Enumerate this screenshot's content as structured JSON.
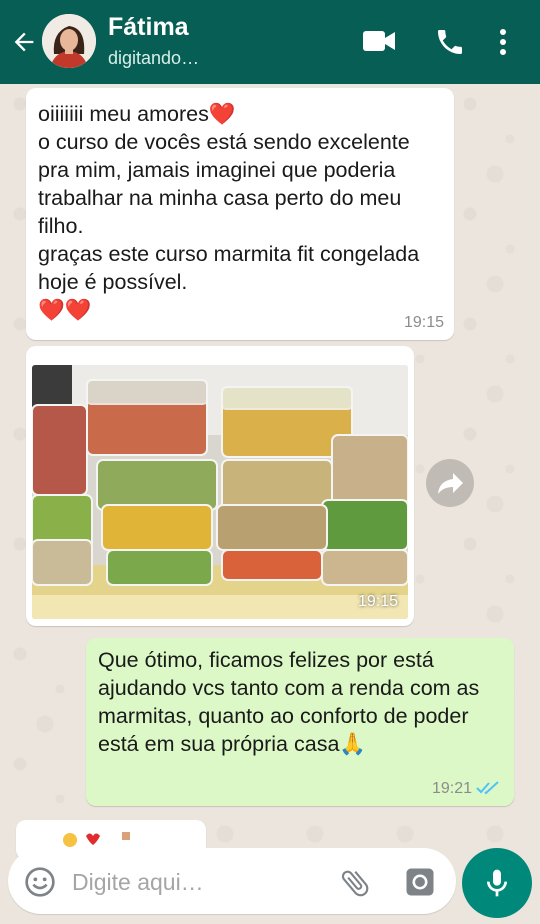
{
  "header": {
    "contact_name": "Fátima",
    "status": "digitando…"
  },
  "messages": [
    {
      "direction": "incoming",
      "text": "oiiiiiii meu amores❤️\no curso de vocês está sendo excelente pra mim, jamais imaginei que poderia trabalhar na minha casa perto do meu filho.\ngraças este curso marmita fit congelada hoje é possível.\n❤️❤️",
      "time": "19:15"
    },
    {
      "direction": "incoming",
      "type": "image",
      "image_description": "marmitas",
      "time": "19:15"
    },
    {
      "direction": "outgoing",
      "text": "Que ótimo, ficamos felizes por está ajudando vcs tanto com a renda com as marmitas, quanto ao conforto de poder está em sua própria casa🙏",
      "time": "19:21",
      "status": "read"
    }
  ],
  "input": {
    "placeholder": "Digite aqui…"
  },
  "colors": {
    "header": "#075e54",
    "outgoing_bubble": "#dcf8c6",
    "incoming_bubble": "#ffffff",
    "read_ticks": "#4fc3f7",
    "mic_button": "#00897b"
  },
  "icons": [
    "back-arrow-icon",
    "video-call-icon",
    "phone-icon",
    "more-vert-icon",
    "forward-icon",
    "emoji-icon",
    "attach-icon",
    "camera-icon",
    "mic-icon"
  ]
}
